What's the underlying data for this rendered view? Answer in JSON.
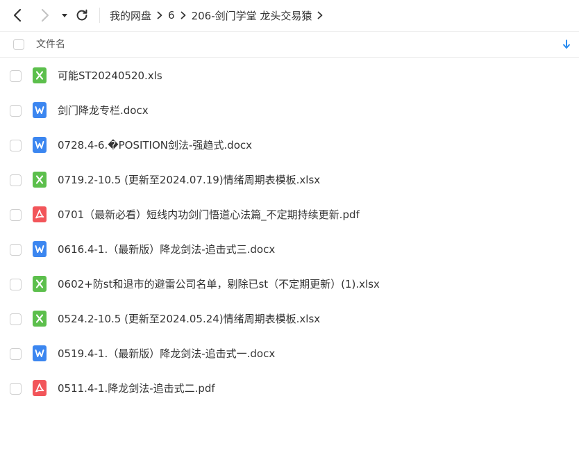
{
  "toolbar": {
    "back_icon": "chevron-left-icon",
    "forward_icon": "chevron-right-icon",
    "history_icon": "caret-down-icon",
    "refresh_icon": "refresh-icon"
  },
  "breadcrumb": {
    "items": [
      "我的网盘",
      "6",
      "206-剑门学堂 龙头交易猿"
    ]
  },
  "header": {
    "name_column": "文件名",
    "sort_icon": "sort-down-icon"
  },
  "colors": {
    "xls": "#5cbf4c",
    "doc": "#3b86f0",
    "pdf": "#f2555a",
    "sort_icon": "#2a8cf0"
  },
  "files": [
    {
      "name": "可能ST20240520.xls",
      "type": "xls"
    },
    {
      "name": "剑门降龙专栏.docx",
      "type": "doc"
    },
    {
      "name": "0728.4-6.�POSITION剑法-强趋式.docx",
      "type": "doc"
    },
    {
      "name": "0719.2-10.5 (更新至2024.07.19)情绪周期表模板.xlsx",
      "type": "xls"
    },
    {
      "name": "0701（最新必看）短线内功剑门悟道心法篇_不定期持续更新.pdf",
      "type": "pdf"
    },
    {
      "name": "0616.4-1.（最新版）降龙剑法-追击式三.docx",
      "type": "doc"
    },
    {
      "name": "0602+防st和退市的避雷公司名单，剔除已st（不定期更新）(1).xlsx",
      "type": "xls"
    },
    {
      "name": "0524.2-10.5 (更新至2024.05.24)情绪周期表模板.xlsx",
      "type": "xls"
    },
    {
      "name": "0519.4-1.（最新版）降龙剑法-追击式一.docx",
      "type": "doc"
    },
    {
      "name": "0511.4-1.降龙剑法-追击式二.pdf",
      "type": "pdf"
    }
  ]
}
